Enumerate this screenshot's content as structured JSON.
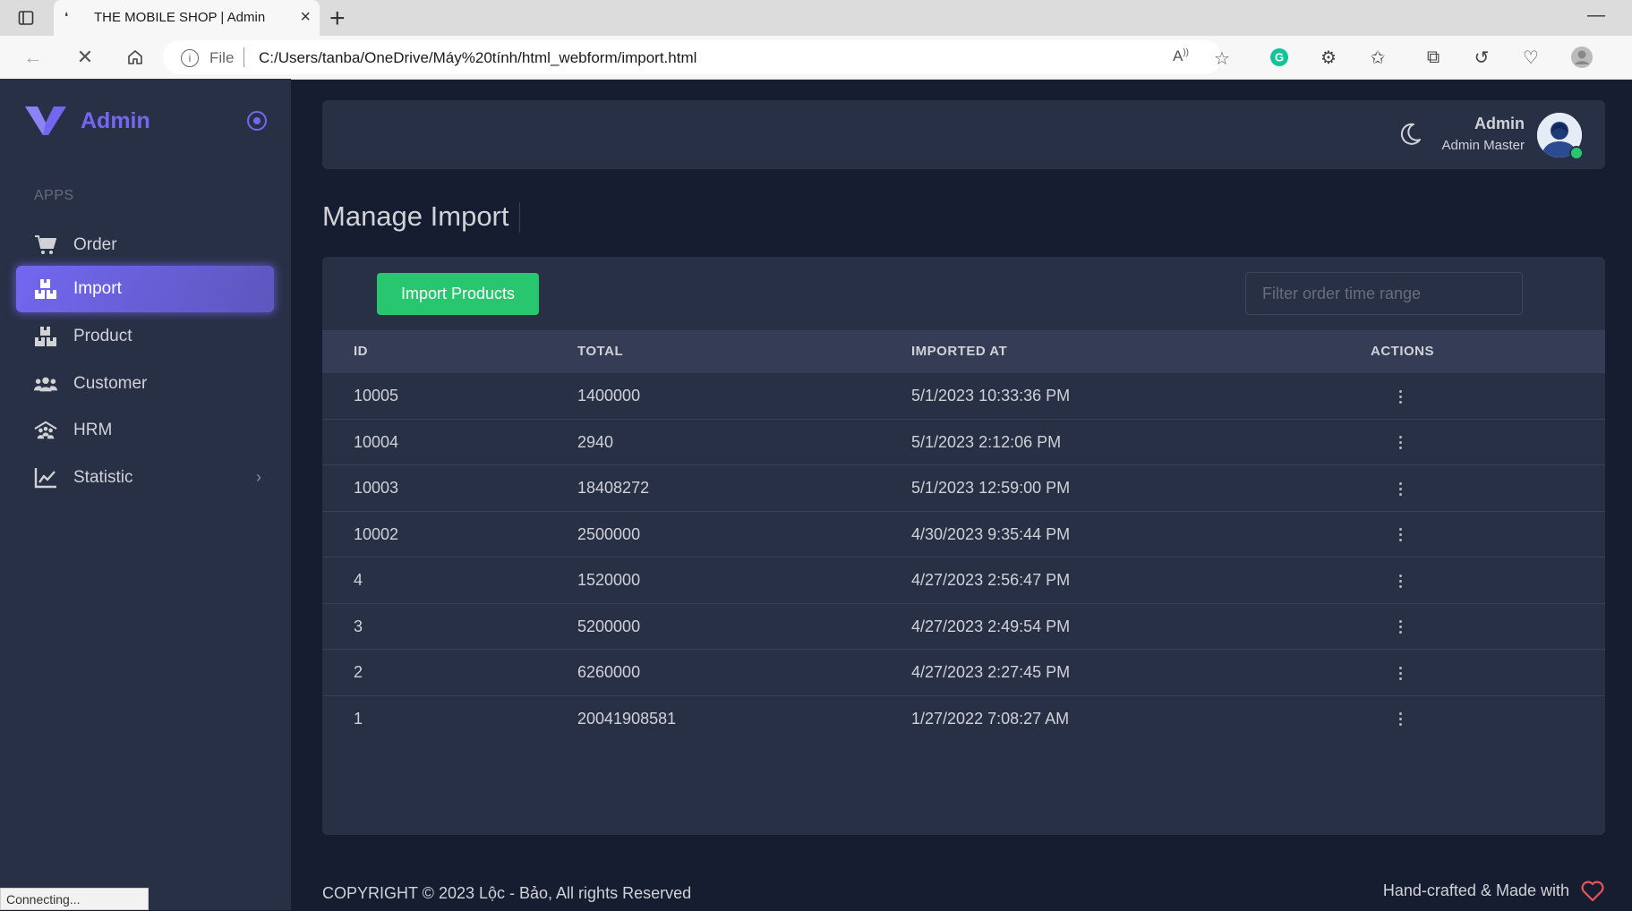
{
  "browser": {
    "tab_title": "THE MOBILE SHOP | Admin",
    "url_scheme_label": "File",
    "url": "C:/Users/tanba/OneDrive/Máy%20tính/html_webform/import.html",
    "status_text": "Connecting..."
  },
  "sidebar": {
    "brand": "Admin",
    "section_label": "APPS",
    "items": [
      {
        "label": "Order",
        "icon": "cart-icon"
      },
      {
        "label": "Import",
        "icon": "boxes-icon",
        "active": true
      },
      {
        "label": "Product",
        "icon": "boxes-icon"
      },
      {
        "label": "Customer",
        "icon": "users-icon"
      },
      {
        "label": "HRM",
        "icon": "people-roof-icon"
      },
      {
        "label": "Statistic",
        "icon": "chart-line-icon",
        "has_submenu": true
      }
    ]
  },
  "topnav": {
    "user_name": "Admin",
    "user_role": "Admin Master"
  },
  "page": {
    "title": "Manage Import"
  },
  "toolbar": {
    "import_button": "Import Products",
    "filter_placeholder": "Filter order time range"
  },
  "table": {
    "columns": [
      "ID",
      "TOTAL",
      "IMPORTED AT",
      "ACTIONS"
    ],
    "rows": [
      {
        "id": "10005",
        "total": "1400000",
        "imported_at": "5/1/2023 10:33:36 PM"
      },
      {
        "id": "10004",
        "total": "2940",
        "imported_at": "5/1/2023 2:12:06 PM"
      },
      {
        "id": "10003",
        "total": "18408272",
        "imported_at": "5/1/2023 12:59:00 PM"
      },
      {
        "id": "10002",
        "total": "2500000",
        "imported_at": "4/30/2023 9:35:44 PM"
      },
      {
        "id": "4",
        "total": "1520000",
        "imported_at": "4/27/2023 2:56:47 PM"
      },
      {
        "id": "3",
        "total": "5200000",
        "imported_at": "4/27/2023 2:49:54 PM"
      },
      {
        "id": "2",
        "total": "6260000",
        "imported_at": "4/27/2023 2:27:45 PM"
      },
      {
        "id": "1",
        "total": "20041908581",
        "imported_at": "1/27/2022 7:08:27 AM"
      }
    ]
  },
  "footer": {
    "copyright": "COPYRIGHT © 2023 Lộc - Bảo, All rights Reserved",
    "made_with": "Hand-crafted & Made with"
  },
  "colors": {
    "primary": "#7367f0",
    "success": "#28c76f",
    "background": "#161d31",
    "card": "#283046"
  }
}
